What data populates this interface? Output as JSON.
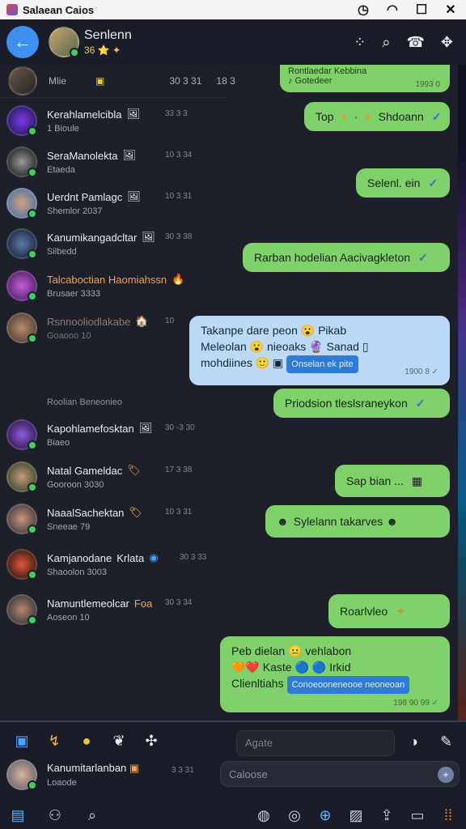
{
  "system_bar": {
    "title": "Salaean Caios",
    "icons": [
      "clock-icon",
      "wifi-icon",
      "maximize-icon",
      "close-icon"
    ]
  },
  "header": {
    "name": "Senlenn",
    "sub": "36 ⭐ ✦",
    "colors": {
      "back_button": "#3d8ff0",
      "accent": "#f4c34a"
    }
  },
  "top_strip": {
    "label": "Mlie",
    "time1": "30 3 31",
    "time2": "18 3",
    "pinned_text": "Rontlaedar Kebbina",
    "pinned_sub": "♪ Gotedeer",
    "pinned_time": "1993 0"
  },
  "chats": [
    {
      "name": "Kerahlamelcibla",
      "badge": "🖼",
      "preview": "1 Bioule",
      "time": "33 3 3"
    },
    {
      "name": "SeraManolekta",
      "badge": "🖼",
      "preview": "Etaeda",
      "time": "10 3 34"
    },
    {
      "name": "Uerdnt Pamlagc",
      "badge": "🖼",
      "preview": "Shemlor 2037",
      "time": "10 3 31"
    },
    {
      "name": "Kanumikangadcltar",
      "badge": "🖼",
      "preview": "Silbedd",
      "time": "30 3 38"
    },
    {
      "name": "Talcaboctian Haomiahssn",
      "badge": "🔥",
      "preview": "Brusaer 3333",
      "time": ""
    },
    {
      "name": "Rsnnooliodlakabe",
      "badge": "🏠",
      "preview": "Goaooo 10",
      "time": "10"
    },
    {
      "name": "Kapohlamefosktan",
      "badge": "🖼",
      "preview": "Biaeo",
      "time": "30 -3 30"
    },
    {
      "name": "Natal Gameldac",
      "badge": "🏷",
      "preview": "Gooroon 3030",
      "time": "17 3 38"
    },
    {
      "name": "NaaalSachektan",
      "badge": "🏷",
      "preview": "Sneeae 79",
      "time": "10 3 31"
    },
    {
      "name": "Kamjanodane",
      "badge": "Krlata",
      "preview": "Shaoolon 3003",
      "time": "30 3 33"
    },
    {
      "name": "Namuntlemeolcar",
      "badge": "Foa",
      "preview": "Aoseon 10",
      "time": "30 3 34"
    }
  ],
  "divider_label": "Roolian Beneonieo",
  "messages": [
    {
      "text": "Top 🔸 · 🔸 Shdoann",
      "time": ""
    },
    {
      "text": "Selenl. ein",
      "time": ""
    },
    {
      "text": "Rarban hodelian Aacivagkleton",
      "time": ""
    },
    {
      "line1": "Takanpe dare peon 😮 Pikab",
      "line2": "Meleolan 😮 nieoaks 🔮 Sanad ▯",
      "line3": "mohdiines 🙂 ▣",
      "chip": "Onselan ek pite",
      "time": "1900 8"
    },
    {
      "text": "Priodsion tleslsraneykon",
      "time": ""
    },
    {
      "text": "Sap bian ...",
      "time": ""
    },
    {
      "text": "Sylelann takarves",
      "time": ""
    },
    {
      "text": "Roarlvleo",
      "time": ""
    },
    {
      "line1": "Peb dielan 😐 vehlabon",
      "line2": "🧡❤️ Kaste 🔵 🔵 Irkid",
      "line3": "Clienltiahs",
      "chip": "Conoeooneneooe neoneoan",
      "time": "198 90 99"
    }
  ],
  "bottom": {
    "search_placeholder": "Agate",
    "composer_placeholder": "Caloose",
    "user_name": "Kanumitarlanban",
    "user_preview": "Loaode",
    "user_time": "3 3 31"
  }
}
